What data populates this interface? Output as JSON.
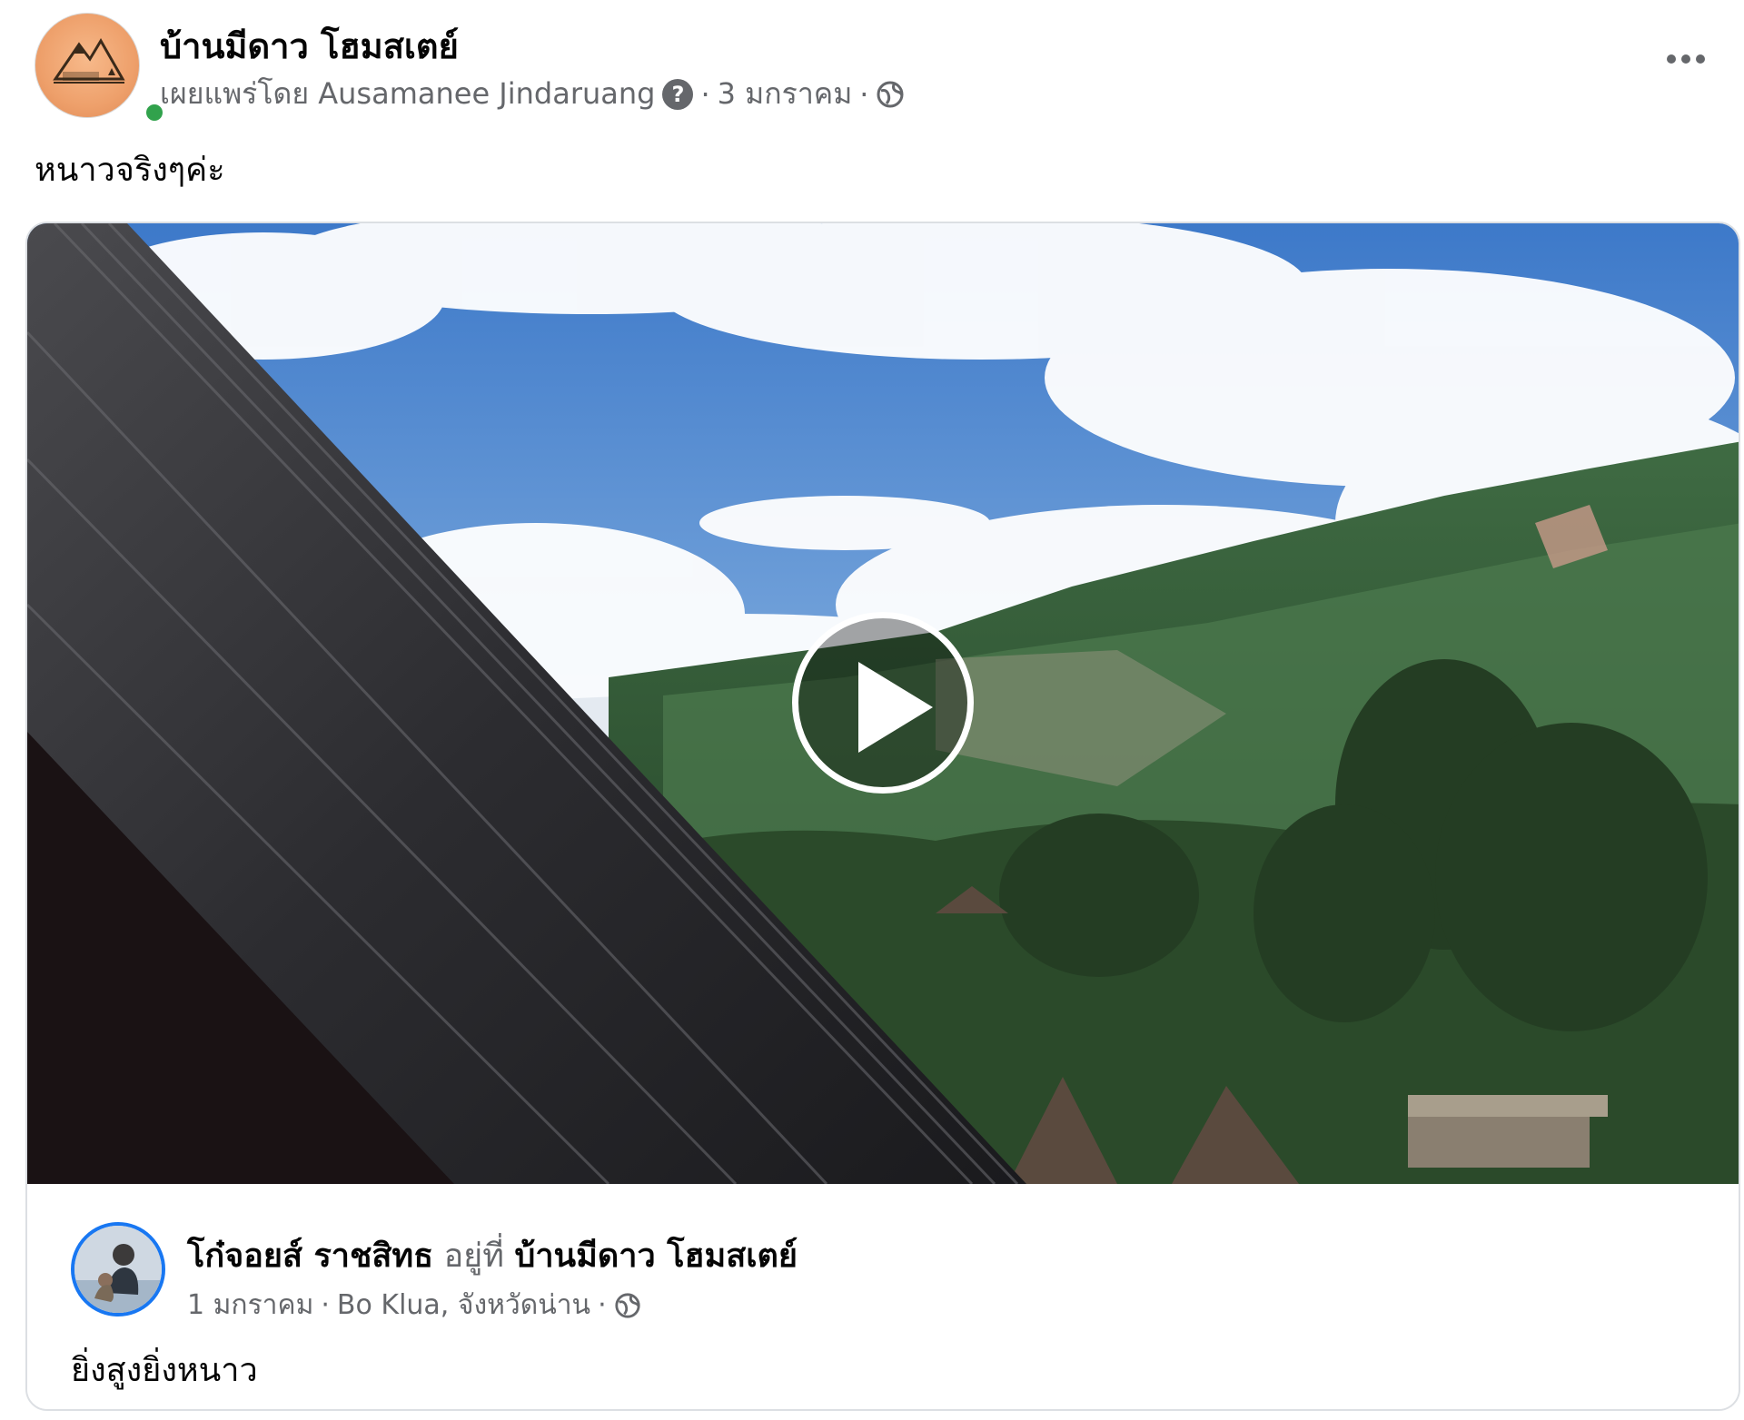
{
  "header": {
    "page_name": "บ้านมีดาว โฮมสเตย์",
    "published_by": "เผยแพร่โดย Ausamanee Jindaruang",
    "date": "3 มกราคม",
    "separator": "·",
    "help_icon_glyph": "?"
  },
  "post": {
    "text": "หนาวจริงๆค่ะ"
  },
  "shared": {
    "user_name": "โก๋จอยส์ ราชสิทธ",
    "at_word": "อยู่ที่",
    "place": "บ้านมีดาว โฮมสเตย์",
    "date": "1 มกราคม",
    "location": "Bo Klua, จังหวัดน่าน",
    "separator": "·",
    "text": "ยิ่งสูงยิ่งหนาว"
  },
  "icons": {
    "globe": "globe-icon",
    "help": "question-icon",
    "more": "more-options-icon",
    "play": "play-icon"
  },
  "colors": {
    "online": "#31a24c",
    "secondary_text": "#65676b",
    "avatar_ring": "#1877f2",
    "logo_bg": "#eea06b"
  }
}
